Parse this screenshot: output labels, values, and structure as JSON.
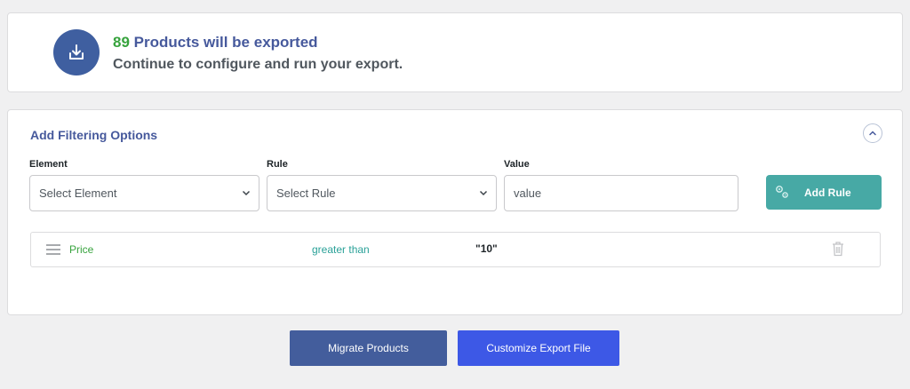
{
  "summary": {
    "count": "89",
    "headline_text": "Products will be exported",
    "subtext": "Continue to configure and run your export.",
    "icon": "download-icon"
  },
  "filters": {
    "title": "Add Filtering Options",
    "element_label": "Element",
    "element_value": "Select Element",
    "rule_label": "Rule",
    "rule_value": "Select Rule",
    "value_label": "Value",
    "value_placeholder": "value",
    "add_rule_label": "Add Rule",
    "rules": [
      {
        "element": "Price",
        "operator": "greater than",
        "value": "\"10\""
      }
    ]
  },
  "actions": {
    "migrate_label": "Migrate Products",
    "customize_label": "Customize Export File"
  },
  "colors": {
    "accent_blue": "#46599c",
    "success_green": "#37a33d",
    "teal_button": "#47a9a5",
    "primary_blue": "#3d58e6",
    "secondary_blue": "#435d9c"
  }
}
